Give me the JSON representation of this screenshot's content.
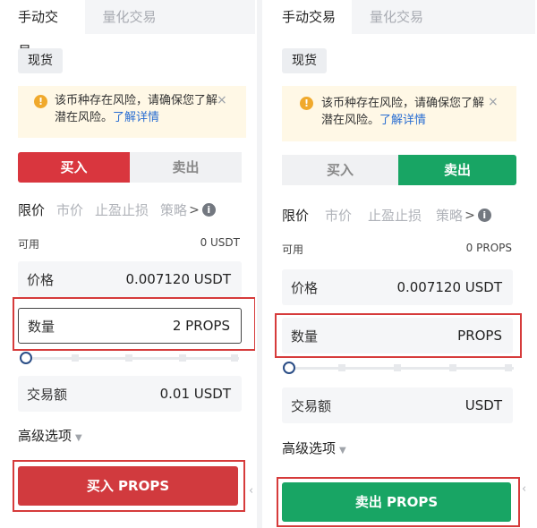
{
  "left": {
    "tabs": [
      "手动交易",
      "量化交易"
    ],
    "chip": "现货",
    "notice": {
      "text": "该币种存在风险，请确保您了解潜在风险。",
      "link": "了解详情",
      "close": "×"
    },
    "seg": {
      "buy": "买入",
      "sell": "卖出"
    },
    "order_types": [
      "限价",
      "市价",
      "止盈止损",
      "策略"
    ],
    "more_arrow": ">",
    "info_icon": "i",
    "available": {
      "label": "可用",
      "value": "0 USDT"
    },
    "price": {
      "label": "价格",
      "value": "0.007120 USDT"
    },
    "amount": {
      "label": "数量",
      "value": "2 PROPS"
    },
    "total": {
      "label": "交易额",
      "value": "0.01 USDT"
    },
    "advanced": "高级选项",
    "submit": "买入 PROPS",
    "side_caret": "‹"
  },
  "right": {
    "tabs": [
      "手动交易",
      "量化交易"
    ],
    "chip": "现货",
    "notice": {
      "text": "该币种存在风险，请确保您了解潜在风险。",
      "link": "了解详情",
      "close": "×"
    },
    "seg": {
      "buy": "买入",
      "sell": "卖出"
    },
    "order_types": [
      "限价",
      "市价",
      "止盈止损",
      "策略"
    ],
    "more_arrow": ">",
    "info_icon": "i",
    "available": {
      "label": "可用",
      "value": "0 PROPS"
    },
    "price": {
      "label": "价格",
      "value": "0.007120 USDT"
    },
    "amount": {
      "label": "数量",
      "value": "PROPS"
    },
    "total": {
      "label": "交易额",
      "value": "USDT"
    },
    "advanced": "高级选项",
    "submit": "卖出 PROPS",
    "side_caret": "‹"
  },
  "colors": {
    "buy": "#d9363e",
    "sell": "#18a564",
    "highlight_box": "#d63b3b",
    "link": "#2a6ed2"
  },
  "slider": {
    "level": 0
  }
}
